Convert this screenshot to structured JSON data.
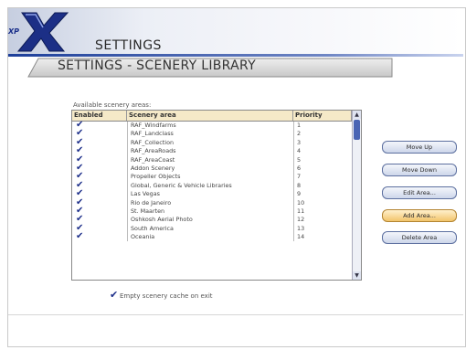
{
  "header": {
    "logo_text": "XP",
    "title": "SETTINGS",
    "subtitle": "SETTINGS - SCENERY LIBRARY"
  },
  "scenery": {
    "section_label": "Available scenery areas:",
    "columns": [
      "Enabled",
      "Scenery area",
      "Priority"
    ],
    "rows": [
      {
        "name": "RAF_Windfarms",
        "priority": "1",
        "enabled": true
      },
      {
        "name": "RAF_Landclass",
        "priority": "2",
        "enabled": true
      },
      {
        "name": "RAF_Collection",
        "priority": "3",
        "enabled": true
      },
      {
        "name": "RAF_AreaRoads",
        "priority": "4",
        "enabled": true
      },
      {
        "name": "RAF_AreaCoast",
        "priority": "5",
        "enabled": true
      },
      {
        "name": "Addon Scenery",
        "priority": "6",
        "enabled": true
      },
      {
        "name": "Propeller Objects",
        "priority": "7",
        "enabled": true
      },
      {
        "name": "Global, Generic & Vehicle Libraries",
        "priority": "8",
        "enabled": true
      },
      {
        "name": "Las Vegas",
        "priority": "9",
        "enabled": true
      },
      {
        "name": "Rio de Janeiro",
        "priority": "10",
        "enabled": true
      },
      {
        "name": "St. Maarten",
        "priority": "11",
        "enabled": true
      },
      {
        "name": "Oshkosh Aerial Photo",
        "priority": "12",
        "enabled": true
      },
      {
        "name": "South America",
        "priority": "13",
        "enabled": true
      },
      {
        "name": "Oceania",
        "priority": "14",
        "enabled": true
      }
    ],
    "check_icon": "check-icon"
  },
  "actions": {
    "move_up": "Move Up",
    "move_down": "Move Down",
    "edit_area": "Edit Area...",
    "add_area": "Add Area...",
    "delete_area": "Delete Area"
  },
  "options": {
    "empty_cache_label": "Empty scenery cache on exit",
    "empty_cache_checked": true
  },
  "colors": {
    "accent": "#1d3f9a",
    "header_bg": "#f5e9c8",
    "active_button": "#f2c46b"
  }
}
